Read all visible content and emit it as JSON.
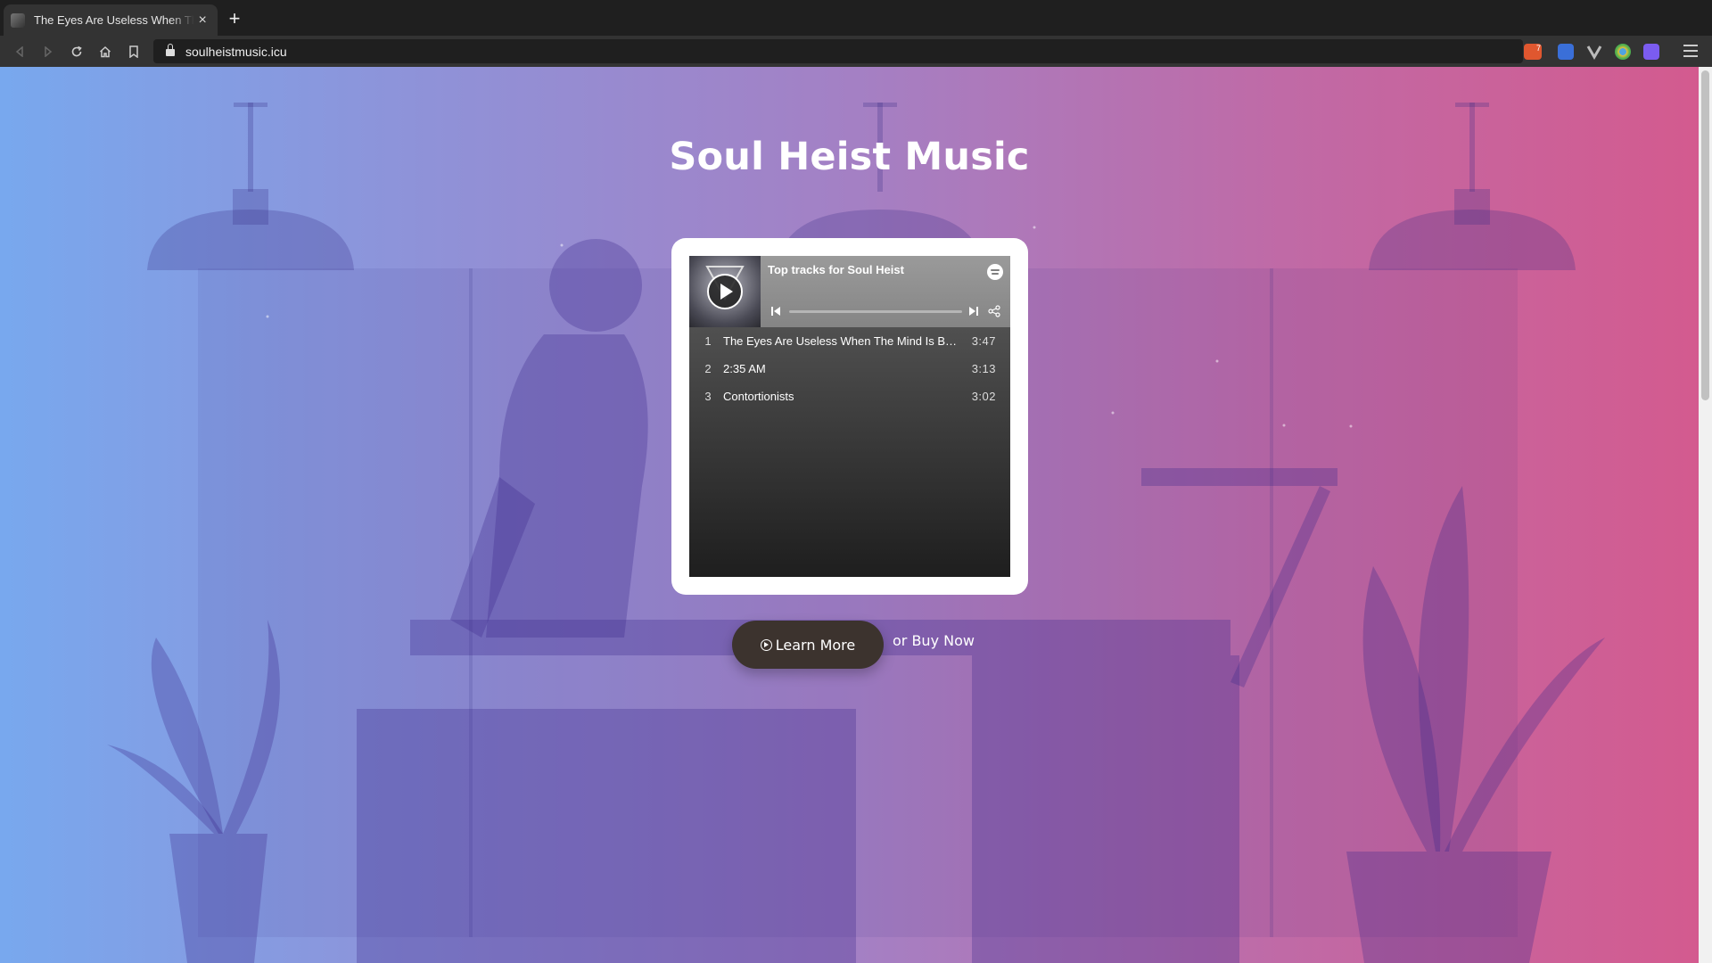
{
  "browser": {
    "tab_title": "The Eyes Are Useless When The Mind Is Blind",
    "tab_close": "×",
    "new_tab": "+",
    "url": "soulheistmusic.icu",
    "brave_badge": "7",
    "nav": {
      "back_icon": "back-arrow-icon",
      "forward_icon": "forward-arrow-icon",
      "reload_icon": "reload-icon",
      "home_icon": "home-icon",
      "bookmark_icon": "bookmark-icon"
    }
  },
  "page": {
    "title": "Soul Heist Music",
    "player": {
      "heading": "Top tracks for Soul Heist",
      "tracks": [
        {
          "num": "1",
          "name": "The Eyes Are Useless When The Mind Is Blind",
          "duration": "3:47"
        },
        {
          "num": "2",
          "name": "2:35 AM",
          "duration": "3:13"
        },
        {
          "num": "3",
          "name": "Contortionists",
          "duration": "3:02"
        }
      ]
    },
    "cta": {
      "learn_more": "Learn More",
      "buy_now": "or Buy Now"
    }
  },
  "colors": {
    "gradient_left": "#78a8ee",
    "gradient_right": "#d45a8e",
    "button_bg": "#3c332e"
  }
}
